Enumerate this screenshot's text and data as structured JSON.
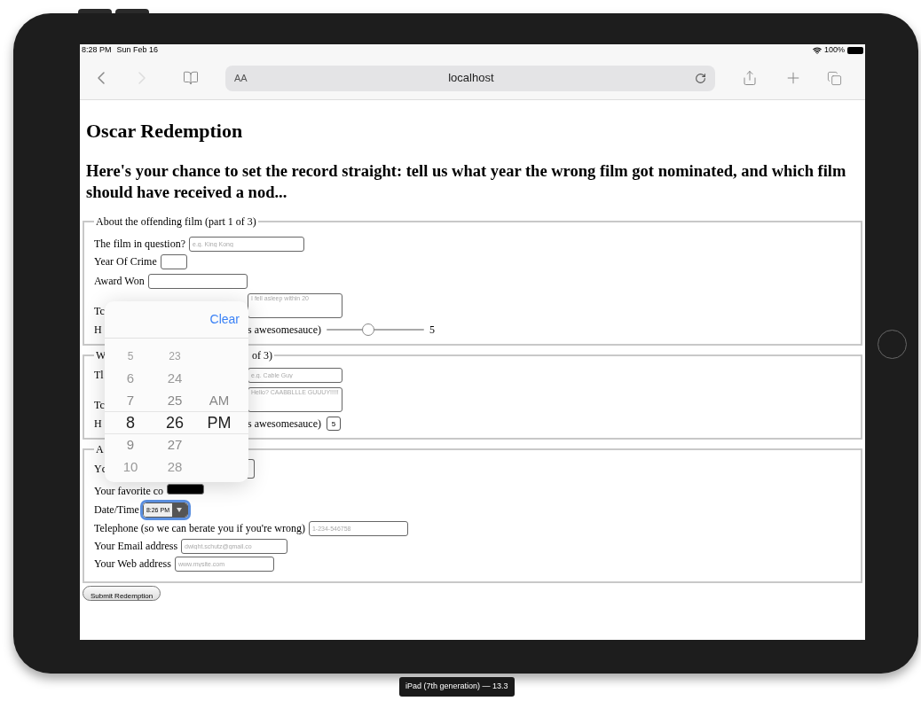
{
  "status_bar": {
    "time": "8:28 PM",
    "date": "Sun Feb 16",
    "battery": "100%"
  },
  "toolbar": {
    "forward_disabled": true,
    "text_size": "AA",
    "address": "localhost"
  },
  "page": {
    "title": "Oscar Redemption",
    "subtitle": "Here's your chance to set the record straight: tell us what year the wrong film got nominated, and which film should have received a nod...",
    "sections": [
      {
        "legend": [
          "About the offending film (part 1 of 3)"
        ],
        "rows": [
          {
            "items": [
              {
                "kind": "label",
                "text": "The film in question?"
              },
              {
                "kind": "input",
                "placeholder": "e.g. King Kong"
              }
            ]
          },
          {
            "items": [
              {
                "kind": "label",
                "text": "Year Of Crime"
              },
              {
                "kind": "input"
              }
            ]
          },
          {
            "items": [
              {
                "kind": "label",
                "text": "Award Won"
              },
              {
                "kind": "input"
              }
            ]
          },
          {
            "items": [
              {
                "kind": "covered",
                "text": "Tc"
              },
              {
                "kind": "textarea",
                "placeholder": "I fell asleep within 20"
              }
            ]
          },
          {
            "items": [
              {
                "kind": "covered",
                "text": "H"
              },
              {
                "kind": "label",
                "text": "s awesomesauce)"
              },
              {
                "kind": "slider",
                "level": 0.43
              },
              {
                "kind": "reading",
                "text": "5"
              }
            ]
          }
        ]
      },
      {
        "legend": [
          "W",
          "of 3)"
        ],
        "rows": [
          {
            "items": [
              {
                "kind": "covered",
                "text": "Tl"
              },
              {
                "kind": "input",
                "placeholder": "e.g. Cable Guy"
              }
            ]
          },
          {
            "items": [
              {
                "kind": "covered",
                "text": "Tc"
              },
              {
                "kind": "textarea",
                "placeholder": "Hello? CAABBLLLE GUUUY!!!!!"
              }
            ]
          },
          {
            "items": [
              {
                "kind": "covered",
                "text": "H"
              },
              {
                "kind": "label",
                "text": "s awesomesauce)"
              },
              {
                "kind": "number",
                "value": "5"
              }
            ]
          }
        ]
      },
      {
        "legend": [
          "A"
        ],
        "rows": [
          {
            "items": [
              {
                "kind": "covered",
                "text": "Yc"
              },
              {
                "kind": "input"
              }
            ]
          },
          {
            "items": [
              {
                "kind": "label",
                "text": "Your favorite co"
              },
              {
                "kind": "color",
                "color": "#000000"
              }
            ]
          },
          {
            "items": [
              {
                "kind": "label",
                "text": "Date/Time"
              },
              {
                "kind": "select",
                "value": "8:26 PM",
                "focused": true
              }
            ]
          },
          {
            "items": [
              {
                "kind": "label",
                "text": "Telephone (so we can berate you if you're wrong)"
              },
              {
                "kind": "input",
                "placeholder": "1-234-546758"
              }
            ]
          },
          {
            "items": [
              {
                "kind": "label",
                "text": "Your Email address"
              },
              {
                "kind": "input",
                "placeholder": "dwight.schutz@gmail.co"
              }
            ]
          },
          {
            "items": [
              {
                "kind": "label",
                "text": "Your Web address"
              },
              {
                "kind": "input",
                "placeholder": "www.mysite.com"
              }
            ]
          }
        ]
      }
    ],
    "submit": "Submit Redemption"
  },
  "time_picker": {
    "action": "Clear",
    "columns": [
      {
        "items": [
          {
            "text": "5",
            "selected": false
          },
          {
            "text": "6",
            "selected": false
          },
          {
            "text": "7",
            "selected": false
          },
          {
            "text": "8",
            "selected": true
          },
          {
            "text": "9",
            "selected": false
          },
          {
            "text": "10",
            "selected": false
          }
        ]
      },
      {
        "items": [
          {
            "text": "23",
            "selected": false
          },
          {
            "text": "24",
            "selected": false
          },
          {
            "text": "25",
            "selected": false
          },
          {
            "text": "26",
            "selected": true
          },
          {
            "text": "27",
            "selected": false
          },
          {
            "text": "28",
            "selected": false
          }
        ]
      },
      {
        "items": [
          {
            "text": "AM",
            "selected": false
          },
          {
            "text": "PM",
            "selected": true
          }
        ]
      }
    ]
  },
  "device_label": "iPad (7th generation) — 13.3"
}
